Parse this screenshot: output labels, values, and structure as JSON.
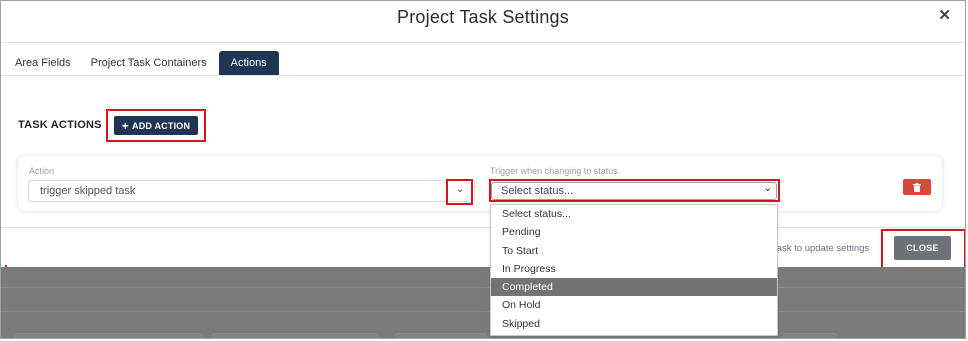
{
  "dialog": {
    "title": "Project Task Settings",
    "close_icon": "close-icon"
  },
  "tabs": [
    {
      "label": "Area Fields",
      "active": false
    },
    {
      "label": "Project Task Containers",
      "active": false
    },
    {
      "label": "Actions",
      "active": true
    }
  ],
  "task_actions": {
    "section_label": "TASK ACTIONS",
    "add_button": {
      "icon": "plus-icon",
      "icon_char": "+",
      "label": "ADD ACTION"
    }
  },
  "action_row": {
    "action_label": "Action",
    "action_value": "trigger skipped task",
    "trigger_label": "Trigger when changing to status",
    "trigger_value": "Select status...",
    "delete_icon": "trash-icon"
  },
  "status_dropdown": {
    "options": [
      "Select status...",
      "Pending",
      "To Start",
      "In Progress",
      "Completed",
      "On Hold",
      "Skipped"
    ],
    "highlighted": "Completed"
  },
  "footer": {
    "hint_text": "ur task to update settings",
    "close_label": "CLOSE"
  },
  "colors": {
    "primary": "#1f3553",
    "highlight_border": "#d8141c",
    "delete": "#d9473c",
    "close_button": "#6d7179",
    "dropdown_selected": "#737373"
  }
}
